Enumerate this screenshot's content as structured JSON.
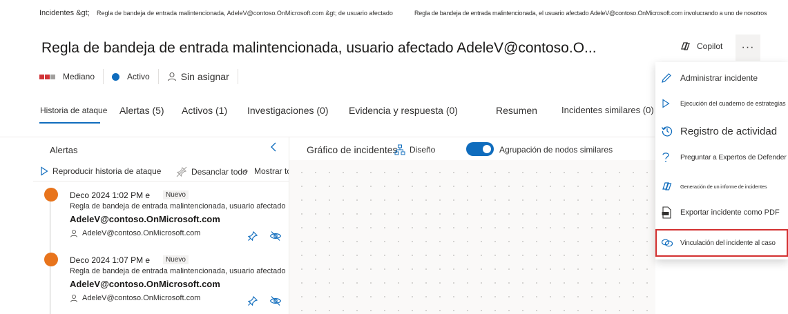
{
  "breadcrumb": {
    "root": "Incidentes &gt;",
    "level1": "Regla de bandeja de entrada malintencionada, AdeleV@contoso.OnMicrosoft.com &gt; de usuario afectado",
    "level2": "Regla de bandeja de entrada malintencionada, el usuario afectado AdeleV@contoso.OnMicrosoft.com involucrando a uno de nosotros"
  },
  "header": {
    "title": "Regla de bandeja de entrada malintencionada, usuario afectado AdeleV@contoso.O...",
    "copilot_label": "Copilot",
    "more_label": "···"
  },
  "status": {
    "severity": "Mediano",
    "state": "Activo",
    "assignee": "Sin asignar"
  },
  "tabs": [
    {
      "label": "Historia de ataque"
    },
    {
      "label": "Alertas (5)"
    },
    {
      "label": "Activos (1)"
    },
    {
      "label": "Investigaciones (0)"
    },
    {
      "label": "Evidencia y respuesta (0)"
    },
    {
      "label": "Resumen"
    },
    {
      "label": "Incidentes similares (0)"
    }
  ],
  "alerts_panel": {
    "title": "Alertas",
    "replay_label": "Reproducir historia de ataque",
    "unpin_label": "Desanclar todo",
    "show_all_label": "Mostrar todo",
    "items": [
      {
        "time": "Deco 2024 1:02 PM e",
        "badge": "Nuevo",
        "description": "Regla de bandeja de entrada malintencionada, usuario afectado",
        "entity": "AdeleV@contoso.OnMicrosoft.com",
        "user": "AdeleV@contoso.OnMicrosoft.com"
      },
      {
        "time": "Deco 2024 1:07 PM e",
        "badge": "Nuevo",
        "description": "Regla de bandeja de entrada malintencionada, usuario afectado",
        "entity": "AdeleV@contoso.OnMicrosoft.com",
        "user": "AdeleV@contoso.OnMicrosoft.com"
      }
    ]
  },
  "graph": {
    "title": "Gráfico de incidentes",
    "layout_label": "Diseño",
    "toggle_label": "Agrupación de nodos similares",
    "toggle_on": true
  },
  "menu": {
    "items": [
      {
        "label": "Administrar incidente",
        "icon": "pencil-icon"
      },
      {
        "label": "Ejecución del cuaderno de estrategias",
        "icon": "play-icon"
      },
      {
        "label": "Registro de actividad",
        "icon": "history-icon"
      },
      {
        "label": "Preguntar a Expertos de Defender",
        "icon": "question-icon"
      },
      {
        "label": "Generación de un informe de incidentes",
        "icon": "copilot-icon"
      },
      {
        "label": "Exportar incidente como PDF",
        "icon": "pdf-icon"
      },
      {
        "label": "Vinculación del incidente al caso",
        "icon": "link-icon"
      }
    ]
  },
  "colors": {
    "accent": "#0f6cbd",
    "severity": "#d13438",
    "alert_dot": "#e8741c",
    "highlight": "#d32f2f"
  }
}
